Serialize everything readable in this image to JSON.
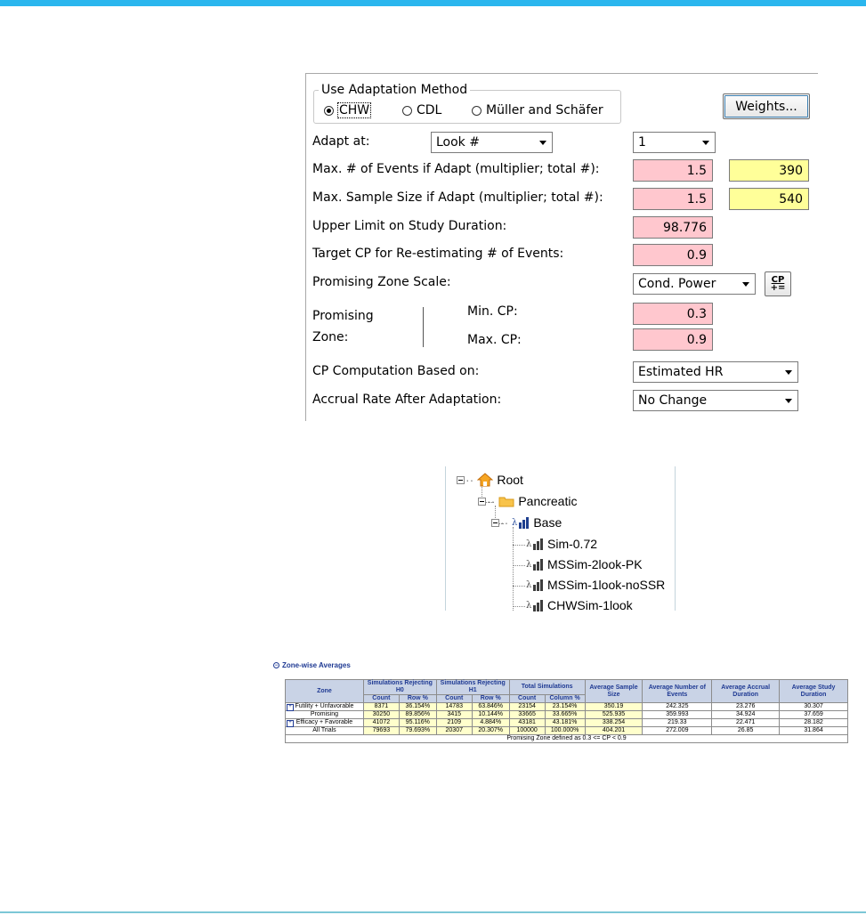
{
  "adaptation": {
    "group_title": "Use Adaptation Method",
    "methods": [
      {
        "label": "CHW",
        "selected": true
      },
      {
        "label": "CDL",
        "selected": false
      },
      {
        "label": "Müller and Schäfer",
        "selected": false
      }
    ],
    "weights_button": "Weights...",
    "adapt_at_label": "Adapt at:",
    "adapt_at_value": "Look #",
    "look_value": "1",
    "max_events_label": "Max. # of Events if Adapt (multiplier; total #):",
    "max_events_multiplier": "1.5",
    "max_events_total": "390",
    "max_sample_label": "Max. Sample Size if Adapt (multiplier; total #):",
    "max_sample_multiplier": "1.5",
    "max_sample_total": "540",
    "upper_limit_label": "Upper Limit on Study Duration:",
    "upper_limit_value": "98.776",
    "target_cp_label": "Target CP for Re-estimating # of Events:",
    "target_cp_value": "0.9",
    "pz_scale_label": "Promising Zone Scale:",
    "pz_scale_value": "Cond. Power",
    "cp_icon_text": "CP",
    "promising_label_1": "Promising",
    "promising_label_2": "Zone:",
    "min_cp_label": "Min. CP:",
    "min_cp_value": "0.3",
    "max_cp_label": "Max. CP:",
    "max_cp_value": "0.9",
    "cp_computation_label": "CP Computation Based on:",
    "cp_computation_value": "Estimated HR",
    "accrual_label": "Accrual Rate After Adaptation:",
    "accrual_value": "No Change"
  },
  "tree": {
    "root": "Root",
    "folder": "Pancreatic",
    "base": "Base",
    "sims": [
      "Sim-0.72",
      "MSSim-2look-PK",
      "MSSim-1look-noSSR",
      "CHWSim-1look"
    ]
  },
  "zone_table": {
    "title": "Zone-wise Averages",
    "headers": {
      "zone": "Zone",
      "rej_h0": "Simulations Rejecting H0",
      "rej_h1": "Simulations Rejecting H1",
      "total": "Total Simulations",
      "avg_sample": "Average Sample Size",
      "avg_events": "Average Number of Events",
      "avg_accrual": "Average Accrual Duration",
      "avg_study": "Average Study Duration",
      "count": "Count",
      "row_pct": "Row %",
      "col_pct": "Column %"
    },
    "rows": [
      {
        "zone": "Futility + Unfavorable",
        "expand": true,
        "h0_count": "8371",
        "h0_pct": "36.154%",
        "h1_count": "14783",
        "h1_pct": "63.846%",
        "t_count": "23154",
        "t_pct": "23.154%",
        "avg_sample": "350.19",
        "avg_events": "242.325",
        "avg_accrual": "23.276",
        "avg_study": "30.307"
      },
      {
        "zone": "Promising",
        "expand": false,
        "h0_count": "30250",
        "h0_pct": "89.856%",
        "h1_count": "3415",
        "h1_pct": "10.144%",
        "t_count": "33665",
        "t_pct": "33.665%",
        "avg_sample": "525.935",
        "avg_events": "359.993",
        "avg_accrual": "34.924",
        "avg_study": "37.659"
      },
      {
        "zone": "Efficacy + Favorable",
        "expand": true,
        "h0_count": "41072",
        "h0_pct": "95.116%",
        "h1_count": "2109",
        "h1_pct": "4.884%",
        "t_count": "43181",
        "t_pct": "43.181%",
        "avg_sample": "338.254",
        "avg_events": "219.33",
        "avg_accrual": "22.471",
        "avg_study": "28.182"
      },
      {
        "zone": "All Trials",
        "expand": false,
        "h0_count": "79693",
        "h0_pct": "79.693%",
        "h1_count": "20307",
        "h1_pct": "20.307%",
        "t_count": "100000",
        "t_pct": "100.000%",
        "avg_sample": "404.201",
        "avg_events": "272.009",
        "avg_accrual": "26.85",
        "avg_study": "31.864"
      }
    ],
    "footer": "Promising Zone defined as 0.3 <= CP < 0.9"
  },
  "colors": {
    "top_bar": "#2ab6ee",
    "pink_field": "#ffc7ce",
    "yellow_field": "#ffff99",
    "table_header": "#c9d3e6",
    "table_header_text": "#1f3a93"
  }
}
